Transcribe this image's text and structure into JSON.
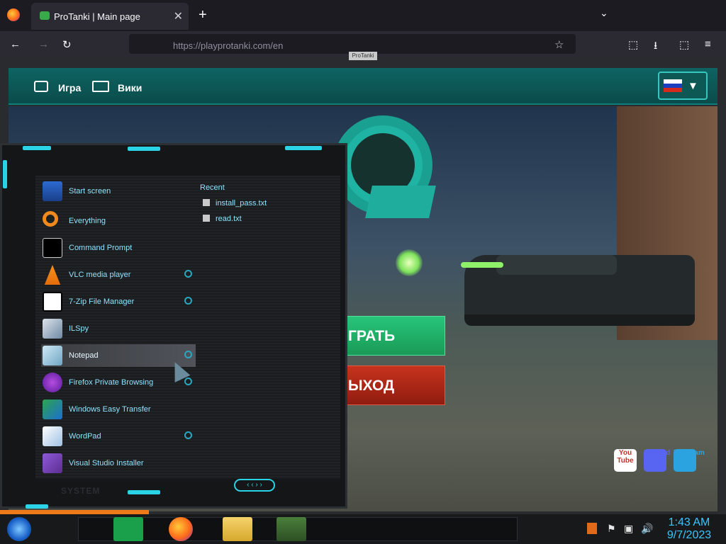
{
  "browser": {
    "tab_title": "ProTanki | Main page",
    "tab_close": "✕",
    "new_tab": "+",
    "tabs_menu": "⌄",
    "url": "https://playprotanki.com/en",
    "nav": {
      "back": "←",
      "forward": "→",
      "reload": "↻"
    },
    "toolbar": {
      "bookmark": "☆",
      "pocket": "⬚",
      "downloads": "⭳",
      "extensions": "⬚",
      "menu": "≡"
    }
  },
  "page": {
    "top_label": "ProTanki",
    "header": {
      "game_label": "Игра",
      "wiki_label": "Вики"
    },
    "language": {
      "flag": "ru",
      "arrow": "▼"
    },
    "buttons": {
      "play": "ГРАТЬ",
      "exit": "ЫХОД"
    },
    "social": [
      "You Tube",
      "Discord",
      "Telegram"
    ],
    "colors": {
      "header": "#0e6462",
      "play": "#27c57a",
      "exit": "#c7331d",
      "accent": "#2bd3e6"
    }
  },
  "start_menu": {
    "items": [
      {
        "label": "Start screen",
        "icon": "start-screen-icon",
        "pinned": false
      },
      {
        "label": "Everything",
        "icon": "search-magnifier-icon",
        "pinned": false
      },
      {
        "label": "Command Prompt",
        "icon": "terminal-icon",
        "pinned": false
      },
      {
        "label": "VLC media player",
        "icon": "vlc-cone-icon",
        "pinned": true
      },
      {
        "label": "7-Zip File Manager",
        "icon": "7zip-icon",
        "pinned": true
      },
      {
        "label": "ILSpy",
        "icon": "ilspy-icon",
        "pinned": false
      },
      {
        "label": "Notepad",
        "icon": "notepad-icon",
        "pinned": true
      },
      {
        "label": "Firefox Private Browsing",
        "icon": "firefox-private-icon",
        "pinned": true
      },
      {
        "label": "Windows Easy Transfer",
        "icon": "easy-transfer-icon",
        "pinned": false
      },
      {
        "label": "WordPad",
        "icon": "wordpad-icon",
        "pinned": true
      },
      {
        "label": "Visual Studio Installer",
        "icon": "visual-studio-icon",
        "pinned": false
      }
    ],
    "recent_header": "Recent",
    "recent_files": [
      "install_pass.txt",
      "read.txt"
    ],
    "system_label": "SYSTEM",
    "scroll_arrows": "‹ ‹ › ›",
    "selected_item": "Notepad"
  },
  "taskbar": {
    "time": "1:43 AM",
    "date": "9/7/2023",
    "tray": [
      "⚑",
      "▣",
      "🔊"
    ],
    "apps": [
      "notes-app-icon",
      "firefox-icon",
      "file-explorer-icon",
      "protanki-icon"
    ]
  }
}
